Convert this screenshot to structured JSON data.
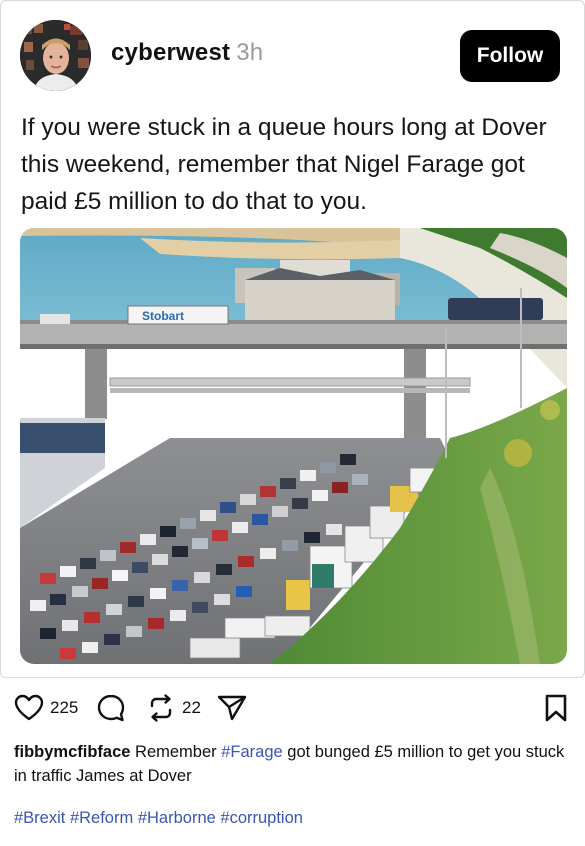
{
  "post": {
    "username": "cyberwest",
    "time": "3h",
    "follow_label": "Follow",
    "text": "If you were stuck in a queue hours long at Dover this weekend, remember that Nigel Farage got paid £5 million to do that to you.",
    "image_sign_text": "Stobart"
  },
  "actions": {
    "likes": "225",
    "reposts": "22",
    "icons": [
      "heart-icon",
      "comment-icon",
      "repost-icon",
      "share-icon",
      "bookmark-icon"
    ]
  },
  "comment": {
    "author": "fibbymcfibface",
    "text_before": " Remember ",
    "hashtag": "#Farage",
    "text_after": " got bunged £5 million to get you stuck in traffic James at Dover",
    "tags": [
      "#Brexit",
      "#Reform",
      "#Harborne",
      "#corruption"
    ]
  },
  "colors": {
    "hashtag": "#3a55b0",
    "follow_bg": "#000000",
    "timestamp": "#9a9a9a"
  }
}
